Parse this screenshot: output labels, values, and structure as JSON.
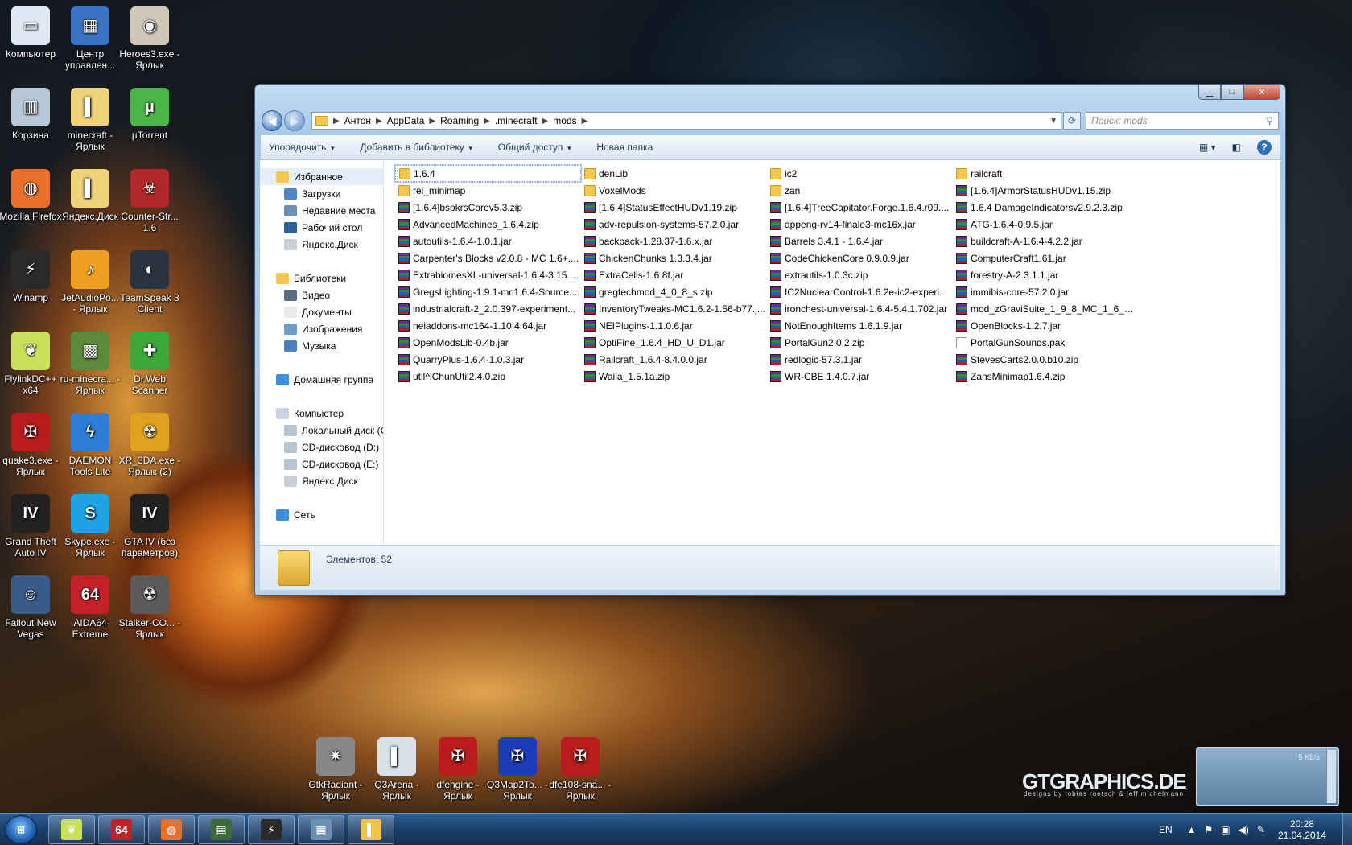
{
  "desktop": {
    "icons": [
      {
        "label": "Компьютер",
        "glyph": "▭",
        "color": "#dfe8f3",
        "shortcut": false
      },
      {
        "label": "Центр управлен...",
        "glyph": "▦",
        "color": "#3a73c4",
        "shortcut": true
      },
      {
        "label": "Heroes3.exe - Ярлык",
        "glyph": "◉",
        "color": "#cfc8b8",
        "shortcut": true
      },
      {
        "label": "Корзина",
        "glyph": "▥",
        "color": "#b9c8d6",
        "shortcut": false
      },
      {
        "label": "minecraft - Ярлык",
        "glyph": "▌",
        "color": "#f0d27a",
        "shortcut": true
      },
      {
        "label": "µTorrent",
        "glyph": "µ",
        "color": "#4bb548",
        "shortcut": false
      },
      {
        "label": "Mozilla Firefox",
        "glyph": "◍",
        "color": "#e8702a",
        "shortcut": false
      },
      {
        "label": "Яндекс.Диск",
        "glyph": "▌",
        "color": "#f0d27a",
        "shortcut": true
      },
      {
        "label": "Counter-Str... 1.6",
        "glyph": "☣",
        "color": "#b0282a",
        "shortcut": false
      },
      {
        "label": "Winamp",
        "glyph": "⚡",
        "color": "#2a2a2a",
        "shortcut": false
      },
      {
        "label": "JetAudioPo... - Ярлык",
        "glyph": "♪",
        "color": "#f0a020",
        "shortcut": true
      },
      {
        "label": "TeamSpeak 3 Client",
        "glyph": "◐",
        "color": "#2a3440",
        "shortcut": false
      },
      {
        "label": "FlylinkDC++ x64",
        "glyph": "❦",
        "color": "#c8e05a",
        "shortcut": false
      },
      {
        "label": "ru-minecra... - Ярлык",
        "glyph": "▩",
        "color": "#5b8a3a",
        "shortcut": true
      },
      {
        "label": "Dr.Web Scanner",
        "glyph": "✚",
        "color": "#3ca83a",
        "shortcut": true
      },
      {
        "label": "quake3.exe - Ярлык",
        "glyph": "✠",
        "color": "#b81c1c",
        "shortcut": true
      },
      {
        "label": "DAEMON Tools Lite",
        "glyph": "ϟ",
        "color": "#2d7fd6",
        "shortcut": true
      },
      {
        "label": "XR_3DA.exe - Ярлык (2)",
        "glyph": "☢",
        "color": "#e0a020",
        "shortcut": true
      },
      {
        "label": "Grand Theft Auto IV",
        "glyph": "IV",
        "color": "#222222",
        "shortcut": false
      },
      {
        "label": "Skype.exe - Ярлык",
        "glyph": "S",
        "color": "#1fa3e6",
        "shortcut": true
      },
      {
        "label": "GTA IV (без параметров)",
        "glyph": "IV",
        "color": "#222222",
        "shortcut": true
      },
      {
        "label": "Fallout New Vegas",
        "glyph": "☺",
        "color": "#3a5a8a",
        "shortcut": true
      },
      {
        "label": "AIDA64 Extreme",
        "glyph": "64",
        "color": "#c4202a",
        "shortcut": false
      },
      {
        "label": "Stalker-CO... - Ярлык",
        "glyph": "☢",
        "color": "#5a5a5a",
        "shortcut": true
      }
    ],
    "bottom_icons": [
      {
        "label": "GtkRadiant - Ярлык",
        "glyph": "✷",
        "color": "#888888"
      },
      {
        "label": "Q3Arena - Ярлык",
        "glyph": "▌",
        "color": "#d8e0ea"
      },
      {
        "label": "dfengine - Ярлык",
        "glyph": "✠",
        "color": "#b81c1c"
      },
      {
        "label": "Q3Map2To... - Ярлык",
        "glyph": "✠",
        "color": "#1c3cb8"
      },
      {
        "label": "dfe108-sna... - Ярлык",
        "glyph": "✠",
        "color": "#b81c1c"
      }
    ]
  },
  "explorer": {
    "buttons": {
      "minimize": "▁",
      "maximize": "□",
      "close": "✕"
    },
    "breadcrumb": [
      "Антон",
      "AppData",
      "Roaming",
      ".minecraft",
      "mods"
    ],
    "search_placeholder": "Поиск: mods",
    "toolbar": [
      "Упорядочить",
      "Добавить в библиотеку",
      "Общий доступ",
      "Новая папка"
    ],
    "nav": [
      {
        "label": "Избранное",
        "level": "top",
        "color": "#f2c94c",
        "selected": true
      },
      {
        "label": "Загрузки",
        "level": "sub",
        "color": "#4d86c8"
      },
      {
        "label": "Недавние места",
        "level": "sub",
        "color": "#6d8fb3"
      },
      {
        "label": "Рабочий стол",
        "level": "sub",
        "color": "#2f5f9a"
      },
      {
        "label": "Яндекс.Диск",
        "level": "sub",
        "color": "#c8cfd8"
      },
      {
        "label": "",
        "level": "gap"
      },
      {
        "label": "Библиотеки",
        "level": "top",
        "color": "#f2c94c"
      },
      {
        "label": "Видео",
        "level": "sub",
        "color": "#5a6b80"
      },
      {
        "label": "Документы",
        "level": "sub",
        "color": "#eaeaea"
      },
      {
        "label": "Изображения",
        "level": "sub",
        "color": "#6f9dc8"
      },
      {
        "label": "Музыка",
        "level": "sub",
        "color": "#4a7fc0"
      },
      {
        "label": "",
        "level": "gap"
      },
      {
        "label": "Домашняя группа",
        "level": "top",
        "color": "#3e8ed8"
      },
      {
        "label": "",
        "level": "gap"
      },
      {
        "label": "Компьютер",
        "level": "top",
        "color": "#c8d4e2"
      },
      {
        "label": "Локальный диск (C",
        "level": "sub",
        "color": "#b8c4d0"
      },
      {
        "label": "CD-дисковод (D:)",
        "level": "sub",
        "color": "#b8c4d0"
      },
      {
        "label": "CD-дисковод (E:)",
        "level": "sub",
        "color": "#b8c4d0"
      },
      {
        "label": "Яндекс.Диск",
        "level": "sub",
        "color": "#c8cfd8"
      },
      {
        "label": "",
        "level": "gap"
      },
      {
        "label": "Сеть",
        "level": "top",
        "color": "#3e8ed8"
      }
    ],
    "files": [
      {
        "name": "1.6.4",
        "type": "folder",
        "focused": true
      },
      {
        "name": "denLib",
        "type": "folder"
      },
      {
        "name": "ic2",
        "type": "folder"
      },
      {
        "name": "railcraft",
        "type": "folder"
      },
      {
        "name": "rei_minimap",
        "type": "folder"
      },
      {
        "name": "VoxelMods",
        "type": "folder"
      },
      {
        "name": "zan",
        "type": "folder"
      },
      {
        "name": "[1.6.4]ArmorStatusHUDv1.15.zip",
        "type": "archive"
      },
      {
        "name": "[1.6.4]bspkrsCorev5.3.zip",
        "type": "archive"
      },
      {
        "name": "[1.6.4]StatusEffectHUDv1.19.zip",
        "type": "archive"
      },
      {
        "name": "[1.6.4]TreeCapitator.Forge.1.6.4.r09....",
        "type": "archive"
      },
      {
        "name": "1.6.4 DamageIndicatorsv2.9.2.3.zip",
        "type": "archive"
      },
      {
        "name": "AdvancedMachines_1.6.4.zip",
        "type": "archive"
      },
      {
        "name": "adv-repulsion-systems-57.2.0.jar",
        "type": "archive"
      },
      {
        "name": "appeng-rv14-finale3-mc16x.jar",
        "type": "archive"
      },
      {
        "name": "ATG-1.6.4-0.9.5.jar",
        "type": "archive"
      },
      {
        "name": "autoutils-1.6.4-1.0.1.jar",
        "type": "archive"
      },
      {
        "name": "backpack-1.28.37-1.6.x.jar",
        "type": "archive"
      },
      {
        "name": "Barrels 3.4.1 - 1.6.4.jar",
        "type": "archive"
      },
      {
        "name": "buildcraft-A-1.6.4-4.2.2.jar",
        "type": "archive"
      },
      {
        "name": "Carpenter's Blocks v2.0.8 - MC 1.6+....",
        "type": "archive"
      },
      {
        "name": "ChickenChunks 1.3.3.4.jar",
        "type": "archive"
      },
      {
        "name": "CodeChickenCore 0.9.0.9.jar",
        "type": "archive"
      },
      {
        "name": "ComputerCraft1.61.jar",
        "type": "archive"
      },
      {
        "name": "ExtrabiomesXL-universal-1.6.4-3.15.7....",
        "type": "archive"
      },
      {
        "name": "ExtraCells-1.6.8f.jar",
        "type": "archive"
      },
      {
        "name": "extrautils-1.0.3c.zip",
        "type": "archive"
      },
      {
        "name": "forestry-A-2.3.1.1.jar",
        "type": "archive"
      },
      {
        "name": "GregsLighting-1.9.1-mc1.6.4-Source....",
        "type": "archive"
      },
      {
        "name": "gregtechmod_4_0_8_s.zip",
        "type": "archive"
      },
      {
        "name": "IC2NuclearControl-1.6.2e-ic2-experi...",
        "type": "archive"
      },
      {
        "name": "immibis-core-57.2.0.jar",
        "type": "archive"
      },
      {
        "name": "industrialcraft-2_2.0.397-experiment...",
        "type": "archive"
      },
      {
        "name": "InventoryTweaks-MC1.6.2-1.56-b77.j...",
        "type": "archive"
      },
      {
        "name": "ironchest-universal-1.6.4-5.4.1.702.jar",
        "type": "archive"
      },
      {
        "name": "mod_zGraviSuite_1_9_8_MC_1_6_4_I...",
        "type": "archive"
      },
      {
        "name": "neiaddons-mc164-1.10.4.64.jar",
        "type": "archive"
      },
      {
        "name": "NEIPlugins-1.1.0.6.jar",
        "type": "archive"
      },
      {
        "name": "NotEnoughItems 1.6.1.9.jar",
        "type": "archive"
      },
      {
        "name": "OpenBlocks-1.2.7.jar",
        "type": "archive"
      },
      {
        "name": "OpenModsLib-0.4b.jar",
        "type": "archive"
      },
      {
        "name": "OptiFine_1.6.4_HD_U_D1.jar",
        "type": "archive"
      },
      {
        "name": "PortalGun2.0.2.zip",
        "type": "archive"
      },
      {
        "name": "PortalGunSounds.pak",
        "type": "file-blank"
      },
      {
        "name": "QuarryPlus-1.6.4-1.0.3.jar",
        "type": "archive"
      },
      {
        "name": "Railcraft_1.6.4-8.4.0.0.jar",
        "type": "archive"
      },
      {
        "name": "redlogic-57.3.1.jar",
        "type": "archive"
      },
      {
        "name": "StevesCarts2.0.0.b10.zip",
        "type": "archive"
      },
      {
        "name": "util^iChunUtil2.4.0.zip",
        "type": "archive"
      },
      {
        "name": "Waila_1.5.1a.zip",
        "type": "archive"
      },
      {
        "name": "WR-CBE 1.4.0.7.jar",
        "type": "archive"
      },
      {
        "name": "ZansMinimap1.6.4.zip",
        "type": "archive"
      }
    ],
    "status_text": "Элементов: 52"
  },
  "taskbar": {
    "start_glyph": "⊞",
    "apps": [
      {
        "glyph": "❦",
        "color": "#c8e05a"
      },
      {
        "glyph": "64",
        "color": "#c4202a"
      },
      {
        "glyph": "◍",
        "color": "#e8702a"
      },
      {
        "glyph": "▤",
        "color": "#3c6a3c"
      },
      {
        "glyph": "⚡",
        "color": "#2a2a2a"
      },
      {
        "glyph": "▦",
        "color": "#6d8fb3"
      },
      {
        "glyph": "▌",
        "color": "#f0c24c"
      }
    ],
    "lang": "EN",
    "time": "20:28",
    "date": "21.04.2014"
  },
  "netmeter": {
    "rate": "5 KB/s"
  },
  "watermark": {
    "main": "GTGRAPHICS.DE",
    "sub": "designs by tobias roetsch & jeff michelmann"
  }
}
